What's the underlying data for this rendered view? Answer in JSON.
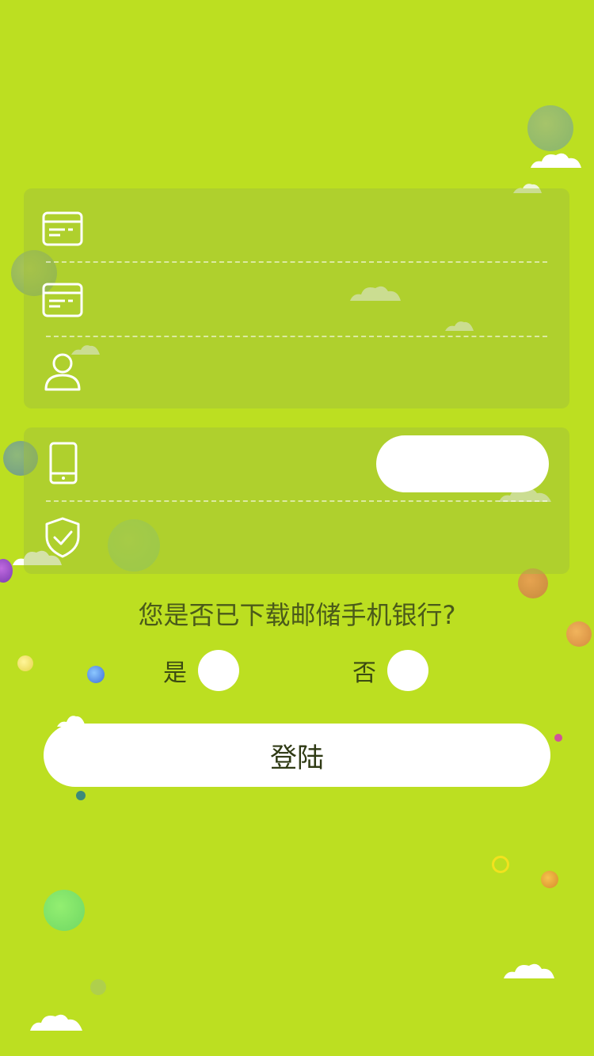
{
  "form": {
    "fields": [
      {
        "name": "card-number",
        "icon": "card-icon",
        "value": ""
      },
      {
        "name": "card-number-confirm",
        "icon": "card-icon",
        "value": ""
      },
      {
        "name": "account-holder",
        "icon": "user-icon",
        "value": ""
      }
    ],
    "verify": [
      {
        "name": "phone",
        "icon": "phone-icon",
        "value": ""
      },
      {
        "name": "sms-code",
        "icon": "shield-check-icon",
        "value": ""
      }
    ],
    "get_code_label": ""
  },
  "question": {
    "text": "您是否已下载邮储手机银行?",
    "yes_label": "是",
    "no_label": "否"
  },
  "login": {
    "label": "登陆"
  },
  "colors": {
    "background": "#bcdf21",
    "panel": "rgba(160,190,60,0.45)",
    "button": "#ffffff"
  }
}
